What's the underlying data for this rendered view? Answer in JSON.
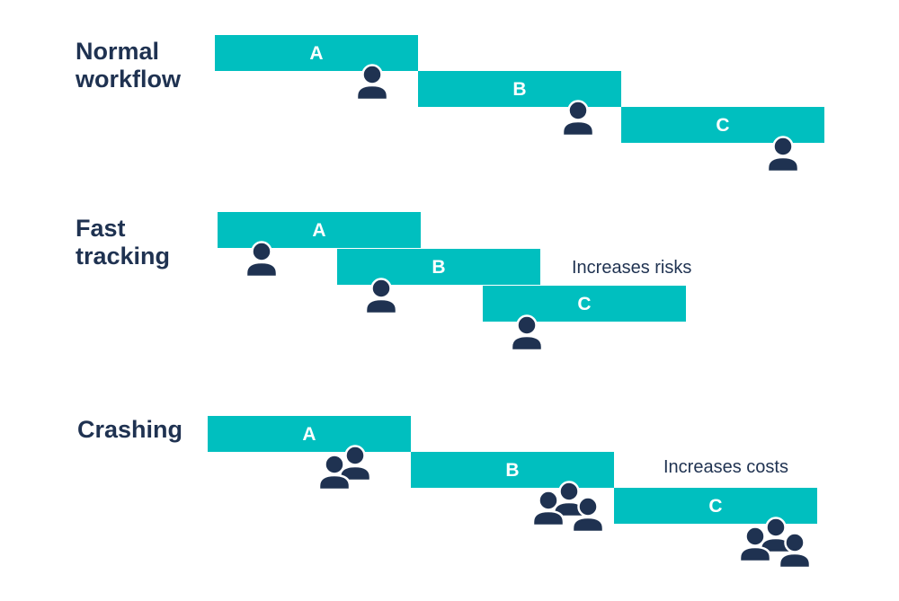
{
  "colors": {
    "bar": "#00bfbf",
    "ink": "#1f3251",
    "outline": "#ffffff",
    "background": "#ffffff"
  },
  "sections": [
    {
      "id": "normal-workflow",
      "title_lines": [
        "Normal",
        "workflow"
      ],
      "note": "",
      "tasks": [
        {
          "label": "A",
          "people": 1
        },
        {
          "label": "B",
          "people": 1
        },
        {
          "label": "C",
          "people": 1
        }
      ]
    },
    {
      "id": "fast-tracking",
      "title_lines": [
        "Fast",
        "tracking"
      ],
      "note": "Increases risks",
      "tasks": [
        {
          "label": "A",
          "people": 1
        },
        {
          "label": "B",
          "people": 1
        },
        {
          "label": "C",
          "people": 1
        }
      ]
    },
    {
      "id": "crashing",
      "title_lines": [
        "Crashing"
      ],
      "note": "Increases costs",
      "tasks": [
        {
          "label": "A",
          "people": 2
        },
        {
          "label": "B",
          "people": 3
        },
        {
          "label": "C",
          "people": 3
        }
      ]
    }
  ]
}
